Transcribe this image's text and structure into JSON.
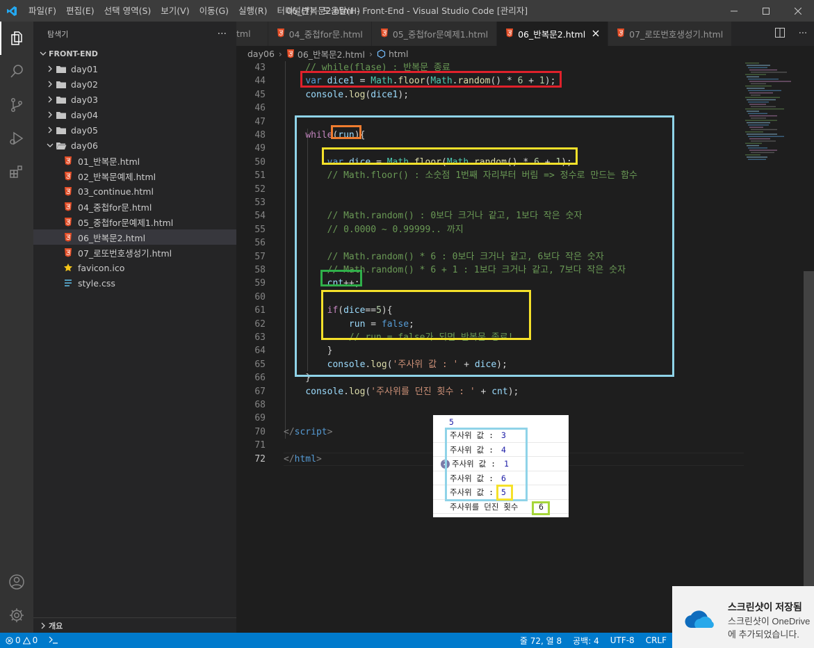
{
  "titlebar": {
    "menu": [
      "파일(F)",
      "편집(E)",
      "선택 영역(S)",
      "보기(V)",
      "이동(G)",
      "실행(R)",
      "터미널(T)",
      "도움말(H)"
    ],
    "title": "06_반복문2.html - Front-End - Visual Studio Code [관리자]"
  },
  "sidebar": {
    "header": "탐색기",
    "more": "···",
    "root": "FRONT-END",
    "folders": [
      "day01",
      "day02",
      "day03",
      "day04",
      "day05",
      "day06"
    ],
    "files": [
      {
        "name": "01_반복문.html",
        "icon": "html-icon"
      },
      {
        "name": "02_반복문예제.html",
        "icon": "html-icon"
      },
      {
        "name": "03_continue.html",
        "icon": "html-icon"
      },
      {
        "name": "04_중첩for문.html",
        "icon": "html-icon"
      },
      {
        "name": "05_중첩for문예제1.html",
        "icon": "html-icon"
      },
      {
        "name": "06_반복문2.html",
        "icon": "html-icon",
        "selected": true
      },
      {
        "name": "07_로또번호생성기.html",
        "icon": "html-icon"
      }
    ],
    "extra_files": [
      {
        "name": "favicon.ico",
        "icon": "star-icon"
      },
      {
        "name": "style.css",
        "icon": "css-icon"
      }
    ],
    "outline": "개요"
  },
  "tabs": [
    {
      "label": "tml",
      "active": false,
      "icon": false
    },
    {
      "label": "04_중첩for문.html",
      "active": false,
      "icon": true
    },
    {
      "label": "05_중첩for문예제1.html",
      "active": false,
      "icon": true
    },
    {
      "label": "06_반복문2.html",
      "active": true,
      "icon": true
    },
    {
      "label": "07_로또번호생성기.html",
      "active": false,
      "icon": true
    }
  ],
  "breadcrumb": [
    "day06",
    "06_반복문2.html",
    "html"
  ],
  "editor": {
    "current_line": 72,
    "lines": [
      {
        "n": 43,
        "t": [
          [
            "cmt",
            "    // while(flase) : 반복문 종료"
          ]
        ]
      },
      {
        "n": 44,
        "t": [
          [
            "p",
            "    "
          ],
          [
            "kw",
            "var"
          ],
          [
            "p",
            " "
          ],
          [
            "var",
            "dice1"
          ],
          [
            "p",
            " = "
          ],
          [
            "cls",
            "Math"
          ],
          [
            "p",
            "."
          ],
          [
            "fn",
            "floor"
          ],
          [
            "p",
            "("
          ],
          [
            "cls",
            "Math"
          ],
          [
            "p",
            "."
          ],
          [
            "fn",
            "random"
          ],
          [
            "p",
            "() * "
          ],
          [
            "num",
            "6"
          ],
          [
            "p",
            " + "
          ],
          [
            "num",
            "1"
          ],
          [
            "p",
            ");"
          ]
        ]
      },
      {
        "n": 45,
        "t": [
          [
            "p",
            "    "
          ],
          [
            "var",
            "console"
          ],
          [
            "p",
            "."
          ],
          [
            "fn",
            "log"
          ],
          [
            "p",
            "("
          ],
          [
            "var",
            "dice1"
          ],
          [
            "p",
            ");"
          ]
        ]
      },
      {
        "n": 46,
        "t": []
      },
      {
        "n": 47,
        "t": []
      },
      {
        "n": 48,
        "t": [
          [
            "p",
            "    "
          ],
          [
            "ctl",
            "while"
          ],
          [
            "p",
            "("
          ],
          [
            "var",
            "run"
          ],
          [
            "p",
            "){"
          ]
        ]
      },
      {
        "n": 49,
        "t": []
      },
      {
        "n": 50,
        "t": [
          [
            "p",
            "        "
          ],
          [
            "kw",
            "var"
          ],
          [
            "p",
            " "
          ],
          [
            "var",
            "dice"
          ],
          [
            "p",
            " = "
          ],
          [
            "cls",
            "Math"
          ],
          [
            "p",
            "."
          ],
          [
            "fn",
            "floor"
          ],
          [
            "p",
            "("
          ],
          [
            "cls",
            "Math"
          ],
          [
            "p",
            "."
          ],
          [
            "fn",
            "random"
          ],
          [
            "p",
            "() * "
          ],
          [
            "num",
            "6"
          ],
          [
            "p",
            " + "
          ],
          [
            "num",
            "1"
          ],
          [
            "p",
            ");"
          ]
        ]
      },
      {
        "n": 51,
        "t": [
          [
            "cmt",
            "        // Math.floor() : 소숫점 1번째 자리부터 버림 => 정수로 만드는 함수"
          ]
        ]
      },
      {
        "n": 52,
        "t": []
      },
      {
        "n": 53,
        "t": []
      },
      {
        "n": 54,
        "t": [
          [
            "cmt",
            "        // Math.random() : 0보다 크거나 같고, 1보다 작은 숫자"
          ]
        ]
      },
      {
        "n": 55,
        "t": [
          [
            "cmt",
            "        // 0.0000 ~ 0.99999.. 까지"
          ]
        ]
      },
      {
        "n": 56,
        "t": []
      },
      {
        "n": 57,
        "t": [
          [
            "cmt",
            "        // Math.random() * 6 : 0보다 크거나 같고, 6보다 작은 숫자"
          ]
        ]
      },
      {
        "n": 58,
        "t": [
          [
            "cmt",
            "        // Math.random() * 6 + 1 : 1보다 크거나 같고, 7보다 작은 숫자"
          ]
        ]
      },
      {
        "n": 59,
        "t": [
          [
            "p",
            "        "
          ],
          [
            "var",
            "cnt"
          ],
          [
            "p",
            "++;"
          ]
        ]
      },
      {
        "n": 60,
        "t": []
      },
      {
        "n": 61,
        "t": [
          [
            "p",
            "        "
          ],
          [
            "ctl",
            "if"
          ],
          [
            "p",
            "("
          ],
          [
            "var",
            "dice"
          ],
          [
            "p",
            "=="
          ],
          [
            "num",
            "5"
          ],
          [
            "p",
            "){"
          ]
        ]
      },
      {
        "n": 62,
        "t": [
          [
            "p",
            "            "
          ],
          [
            "var",
            "run"
          ],
          [
            "p",
            " = "
          ],
          [
            "kw",
            "false"
          ],
          [
            "p",
            ";"
          ]
        ]
      },
      {
        "n": 63,
        "t": [
          [
            "cmt",
            "            // run = false가 되면 반복문 종료!"
          ]
        ]
      },
      {
        "n": 64,
        "t": [
          [
            "p",
            "        }"
          ]
        ]
      },
      {
        "n": 65,
        "t": [
          [
            "p",
            "        "
          ],
          [
            "var",
            "console"
          ],
          [
            "p",
            "."
          ],
          [
            "fn",
            "log"
          ],
          [
            "p",
            "("
          ],
          [
            "str",
            "'주사위 값 : '"
          ],
          [
            "p",
            " + "
          ],
          [
            "var",
            "dice"
          ],
          [
            "p",
            ");"
          ]
        ]
      },
      {
        "n": 66,
        "t": [
          [
            "p",
            "    }"
          ]
        ]
      },
      {
        "n": 67,
        "t": [
          [
            "p",
            "    "
          ],
          [
            "var",
            "console"
          ],
          [
            "p",
            "."
          ],
          [
            "fn",
            "log"
          ],
          [
            "p",
            "("
          ],
          [
            "str",
            "'주사위를 던진 횟수 : '"
          ],
          [
            "p",
            " + "
          ],
          [
            "var",
            "cnt"
          ],
          [
            "p",
            ");"
          ]
        ]
      },
      {
        "n": 68,
        "t": []
      },
      {
        "n": 69,
        "t": []
      },
      {
        "n": 70,
        "t": [
          [
            "pun",
            "</"
          ],
          [
            "tag",
            "script"
          ],
          [
            "pun",
            ">"
          ]
        ]
      },
      {
        "n": 71,
        "t": []
      },
      {
        "n": 72,
        "t": [
          [
            "pun",
            "</"
          ],
          [
            "tag",
            "html"
          ],
          [
            "pun",
            ">"
          ]
        ]
      }
    ]
  },
  "highlight_colors": {
    "red": "#e0212b",
    "cyan": "#8fd3e8",
    "orange": "#ef7c2f",
    "yellow": "#f5e12a",
    "green": "#2fb04a",
    "lime": "#a6d63a"
  },
  "console": {
    "first": "5",
    "rows": [
      {
        "label": "주사위 값 : ",
        "value": "3"
      },
      {
        "label": "주사위 값 : ",
        "value": "4"
      },
      {
        "label": "주사위 값 : ",
        "value": "1",
        "badge": "2"
      },
      {
        "label": "주사위 값 : ",
        "value": "6"
      },
      {
        "label": "주사위 값 : ",
        "value": "5"
      },
      {
        "label": "주사위를 던진 횟수 ",
        "value": "6"
      }
    ]
  },
  "statusbar": {
    "errors": "0",
    "warnings": "0",
    "position": "줄 72, 열 8",
    "spaces": "공백: 4",
    "encoding": "UTF-8",
    "eol": "CRLF"
  },
  "toast": {
    "title": "스크린샷이 저장됨",
    "body": "스크린샷이 OneDrive에 추가되었습니다."
  }
}
